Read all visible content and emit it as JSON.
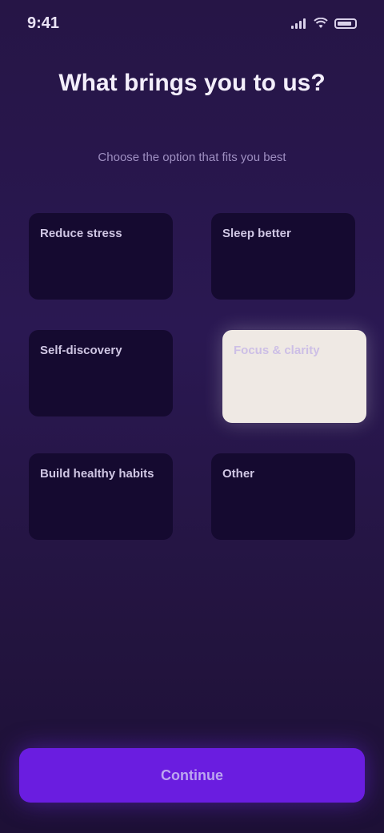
{
  "status_bar": {
    "time": "9:41",
    "icons": [
      "signal-icon",
      "wifi-icon",
      "battery-icon"
    ]
  },
  "header": {
    "title": "What brings you to us?",
    "subtitle": "Choose the option that fits you best"
  },
  "options": [
    {
      "label": "Reduce stress",
      "selected": false
    },
    {
      "label": "Sleep better",
      "selected": false
    },
    {
      "label": "Self-discovery",
      "selected": false
    },
    {
      "label": "Focus & clarity",
      "selected": true
    },
    {
      "label": "Build healthy habits",
      "selected": false
    },
    {
      "label": "Other",
      "selected": false
    }
  ],
  "actions": {
    "continue_label": "Continue"
  },
  "colors": {
    "background": "#2a1852",
    "card": "#150a30",
    "card_selected": "#efe9e4",
    "accent": "#6a1de0"
  }
}
